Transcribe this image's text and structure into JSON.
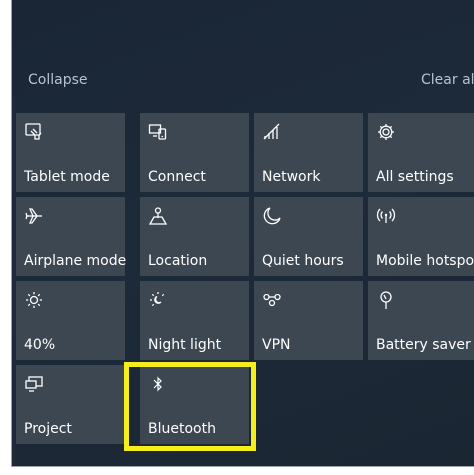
{
  "header": {
    "collapse_label": "Collapse",
    "clear_all_label": "Clear al"
  },
  "tiles": [
    {
      "label": "Tablet mode",
      "icon": "tablet-mode-icon"
    },
    {
      "label": "Connect",
      "icon": "connect-icon"
    },
    {
      "label": "Network",
      "icon": "network-icon"
    },
    {
      "label": "All settings",
      "icon": "gear-icon"
    },
    {
      "label": "Airplane mode",
      "icon": "airplane-icon"
    },
    {
      "label": "Location",
      "icon": "location-icon"
    },
    {
      "label": "Quiet hours",
      "icon": "moon-icon"
    },
    {
      "label": "Mobile hotspot",
      "icon": "hotspot-icon"
    },
    {
      "label": "40%",
      "icon": "brightness-icon"
    },
    {
      "label": "Night light",
      "icon": "night-light-icon"
    },
    {
      "label": "VPN",
      "icon": "vpn-icon"
    },
    {
      "label": "Battery saver",
      "icon": "battery-saver-icon"
    },
    {
      "label": "Project",
      "icon": "project-icon"
    },
    {
      "label": "Bluetooth",
      "icon": "bluetooth-icon"
    }
  ],
  "colors": {
    "panel_bg": "#1b2735",
    "tile_bg": "#3d4752",
    "text": "#ffffff",
    "muted_text": "#b9c2cc",
    "highlight": "#f4ef1c"
  }
}
